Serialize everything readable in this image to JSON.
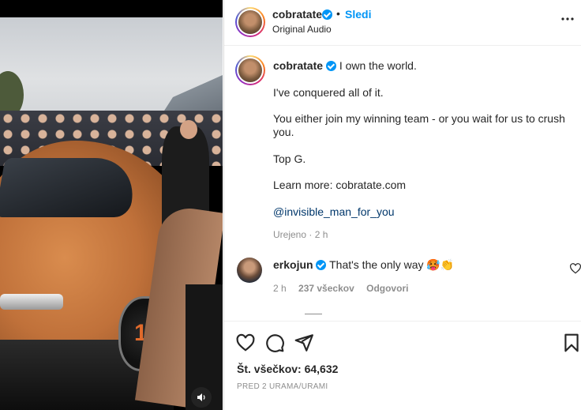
{
  "post": {
    "author": "cobratate",
    "follow_label": "Sledi",
    "dot": "•",
    "audio": "Original Audio",
    "more_label": "•••"
  },
  "caption": {
    "author": "cobratate",
    "line1": "I own the world.",
    "line2": "I've conquered all of it.",
    "line3": "You either join my winning team - or you wait for us to crush you.",
    "line4": "Top G.",
    "line5": "Learn more: cobratate.com",
    "mention": "@invisible_man_for_you",
    "edited": "Urejeno",
    "edited_dot": "·",
    "edited_time": "2 h"
  },
  "comment": {
    "author": "erkojun",
    "text": "That's the only way",
    "emoji": "🥵👏",
    "time": "2 h",
    "likes": "237 všeckov",
    "reply": "Odgovori"
  },
  "engagement": {
    "likes_label": "Št. všečkov: 64,632",
    "time_ago": "PRED 2 URAMA/URAMI"
  },
  "icons": [
    "verified-badge",
    "more-icon",
    "heart-icon",
    "comment-icon",
    "share-icon",
    "bookmark-icon",
    "sound-icon"
  ],
  "colors": {
    "accent": "#0095f6",
    "text": "#262626",
    "muted": "#8e8e8e",
    "mention": "#00376b"
  }
}
